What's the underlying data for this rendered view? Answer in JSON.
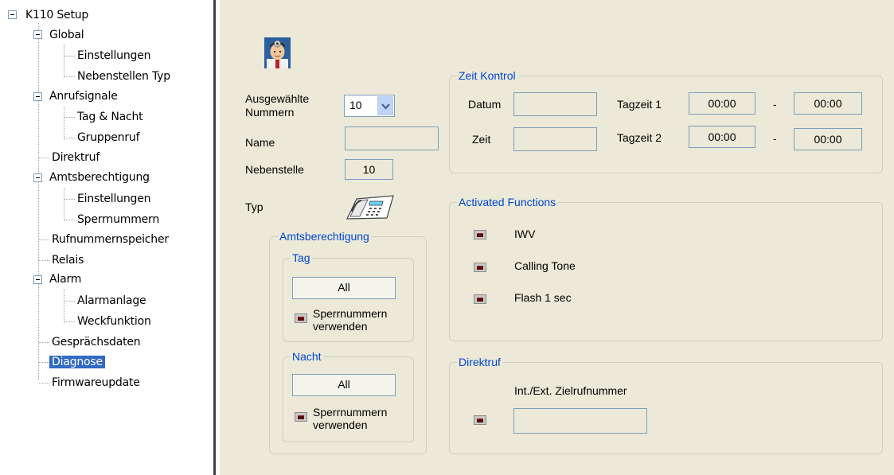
{
  "tree": {
    "root": "K110 Setup",
    "items": [
      {
        "label": "Global"
      },
      {
        "label": "Einstellungen"
      },
      {
        "label": "Nebenstellen Typ"
      },
      {
        "label": "Anrufsignale"
      },
      {
        "label": "Tag & Nacht"
      },
      {
        "label": "Gruppenruf"
      },
      {
        "label": "Direktruf"
      },
      {
        "label": "Amtsberechtigung"
      },
      {
        "label": "Einstellungen"
      },
      {
        "label": "Sperrnummern"
      },
      {
        "label": "Rufnummernspeicher"
      },
      {
        "label": "Relais"
      },
      {
        "label": "Alarm"
      },
      {
        "label": "Alarmanlage"
      },
      {
        "label": "Weckfunktion"
      },
      {
        "label": "Gesprächsdaten"
      },
      {
        "label": "Diagnose"
      },
      {
        "label": "Firmwareupdate"
      }
    ]
  },
  "form": {
    "avatar_icon": "doctor-icon",
    "selected_numbers_label": "Ausgewählte Nummern",
    "selected_numbers_value": "10",
    "name_label": "Name",
    "name_value": "",
    "extension_label": "Nebenstelle",
    "extension_value": "10",
    "type_label": "Typ",
    "type_icon": "telephone-icon"
  },
  "amtsberechtigung": {
    "title": "Amtsberechtigung",
    "tag": {
      "title": "Tag",
      "button": "All",
      "checkbox_label_1": "Sperrnummern",
      "checkbox_label_2": "verwenden"
    },
    "nacht": {
      "title": "Nacht",
      "button": "All",
      "checkbox_label_1": "Sperrnummern",
      "checkbox_label_2": "verwenden"
    }
  },
  "zeit_kontrol": {
    "title": "Zeit Kontrol",
    "datum_label": "Datum",
    "datum_value": "",
    "zeit_label": "Zeit",
    "zeit_value": "",
    "tagzeit1_label": "Tagzeit 1",
    "tagzeit1_from": "00:00",
    "tagzeit1_sep": "-",
    "tagzeit1_to": "00:00",
    "tagzeit2_label": "Tagzeit 2",
    "tagzeit2_from": "00:00",
    "tagzeit2_sep": "-",
    "tagzeit2_to": "00:00"
  },
  "activated_functions": {
    "title": "Activated Functions",
    "items": [
      {
        "label": "IWV"
      },
      {
        "label": "Calling Tone"
      },
      {
        "label": "Flash 1 sec"
      }
    ]
  },
  "direktruf": {
    "title": "Direktruf",
    "field_label": "Int./Ext. Zielrufnummer",
    "field_value": ""
  },
  "colors": {
    "panel_bg": "#ece9d8",
    "group_title": "#0046d5",
    "selection": "#316ac5",
    "field_border": "#7f9db9"
  }
}
